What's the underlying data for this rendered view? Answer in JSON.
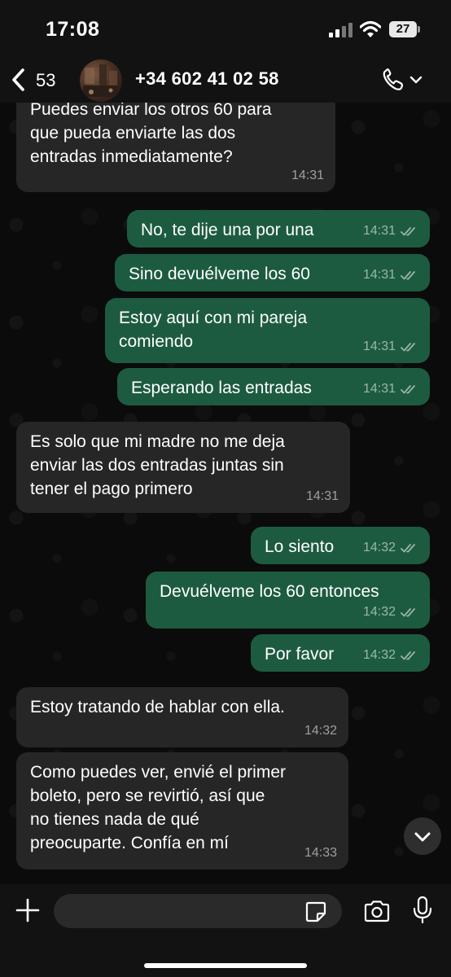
{
  "status_bar": {
    "time": "17:08",
    "battery": "27"
  },
  "header": {
    "back_count": "53",
    "contact": "+34 602 41 02 58"
  },
  "messages": [
    {
      "dir": "in",
      "text": "Puedes enviar los otros 60 para\nque pueda enviarte las dos\nentradas inmediatamente?",
      "time": "14:31"
    },
    {
      "dir": "out",
      "text": "No, te dije una por una",
      "time": "14:31"
    },
    {
      "dir": "out",
      "text": "Sino devuélveme los 60",
      "time": "14:31"
    },
    {
      "dir": "out",
      "text": "Estoy aquí con mi pareja\ncomiendo",
      "time": "14:31"
    },
    {
      "dir": "out",
      "text": "Esperando las entradas",
      "time": "14:31"
    },
    {
      "dir": "in",
      "text": "Es solo que mi madre no me deja\nenviar las dos entradas juntas sin\ntener el pago primero",
      "time": "14:31"
    },
    {
      "dir": "out",
      "text": "Lo siento",
      "time": "14:32"
    },
    {
      "dir": "out",
      "text": "Devuélveme los 60 entonces",
      "time": "14:32"
    },
    {
      "dir": "out",
      "text": "Por favor",
      "time": "14:32"
    },
    {
      "dir": "in",
      "text": "Estoy tratando de hablar con ella.",
      "time": "14:32"
    },
    {
      "dir": "in",
      "text": "Como puedes ver, envié el primer\nboleto, pero se revirtió, así que\nno tienes nada de qué\npreocuparte. Confía en mí",
      "time": "14:33"
    }
  ],
  "input": {
    "value": "",
    "placeholder": ""
  },
  "colors": {
    "outgoing_bubble": "#1d5b41",
    "incoming_bubble": "#262626",
    "background": "#0b0b0b"
  }
}
